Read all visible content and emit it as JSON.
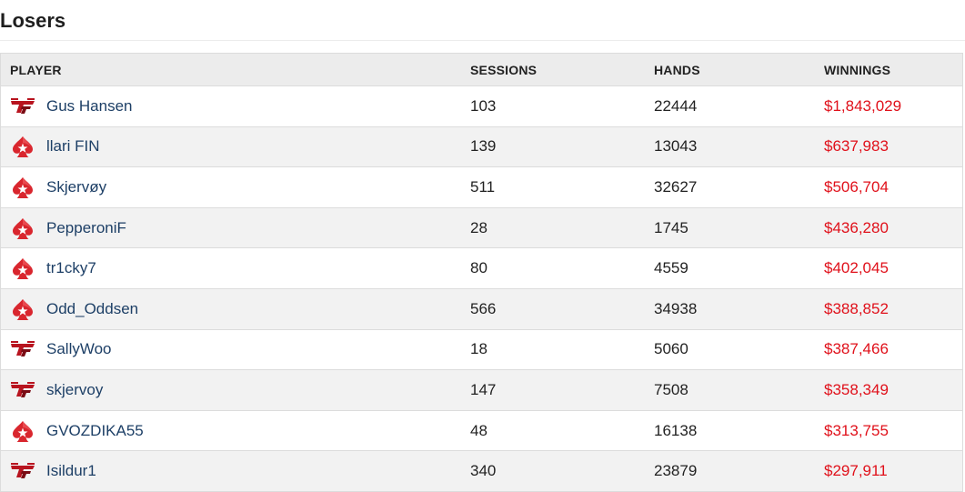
{
  "section": {
    "title": "Losers"
  },
  "table": {
    "headers": {
      "player": "PLAYER",
      "sessions": "SESSIONS",
      "hands": "HANDS",
      "winnings": "WINNINGS"
    },
    "rows": [
      {
        "site_icon": "full-tilt-icon",
        "player": "Gus Hansen",
        "sessions": "103",
        "hands": "22444",
        "winnings": "$1,843,029"
      },
      {
        "site_icon": "pokerstars-icon",
        "player": "llari FIN",
        "sessions": "139",
        "hands": "13043",
        "winnings": "$637,983"
      },
      {
        "site_icon": "pokerstars-icon",
        "player": "Skjervøy",
        "sessions": "511",
        "hands": "32627",
        "winnings": "$506,704"
      },
      {
        "site_icon": "pokerstars-icon",
        "player": "PepperoniF",
        "sessions": "28",
        "hands": "1745",
        "winnings": "$436,280"
      },
      {
        "site_icon": "pokerstars-icon",
        "player": "tr1cky7",
        "sessions": "80",
        "hands": "4559",
        "winnings": "$402,045"
      },
      {
        "site_icon": "pokerstars-icon",
        "player": "Odd_Oddsen",
        "sessions": "566",
        "hands": "34938",
        "winnings": "$388,852"
      },
      {
        "site_icon": "full-tilt-icon",
        "player": "SallyWoo",
        "sessions": "18",
        "hands": "5060",
        "winnings": "$387,466"
      },
      {
        "site_icon": "full-tilt-icon",
        "player": "skjervoy",
        "sessions": "147",
        "hands": "7508",
        "winnings": "$358,349"
      },
      {
        "site_icon": "pokerstars-icon",
        "player": "GVOZDIKA55",
        "sessions": "48",
        "hands": "16138",
        "winnings": "$313,755"
      },
      {
        "site_icon": "full-tilt-icon",
        "player": "Isildur1",
        "sessions": "340",
        "hands": "23879",
        "winnings": "$297,911"
      }
    ]
  },
  "colors": {
    "player_link": "#1d3f66",
    "winnings": "#e0101a",
    "header_bg": "#ececec",
    "row_alt_bg": "#f2f2f2",
    "border": "#dcdcdc"
  }
}
